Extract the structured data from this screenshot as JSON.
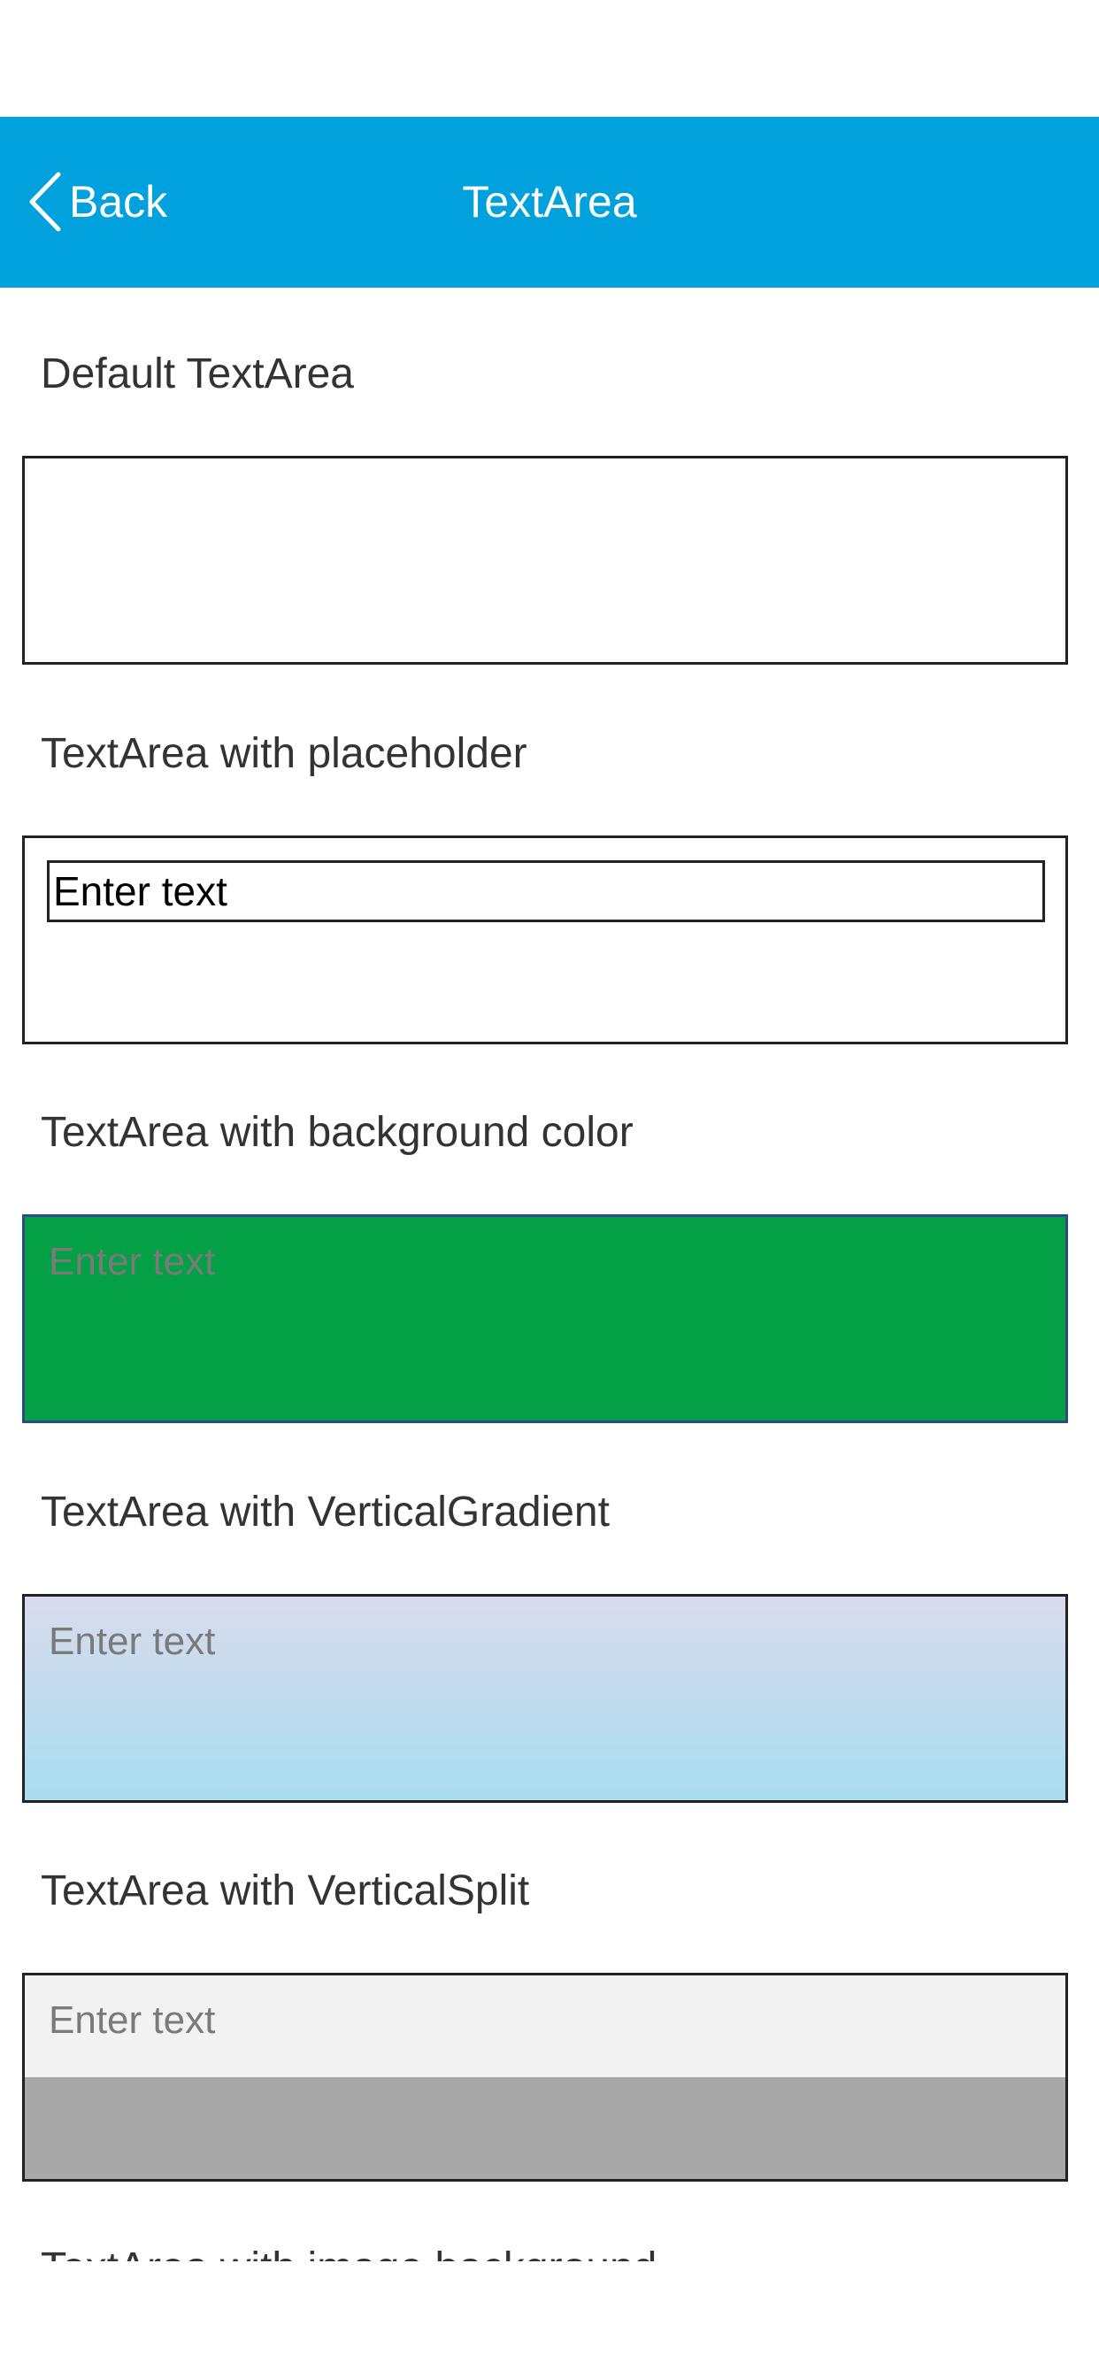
{
  "nav": {
    "back_label": "Back",
    "title": "TextArea",
    "color": "#00a1dd"
  },
  "sections": [
    {
      "label": "Default TextArea",
      "placeholder": ""
    },
    {
      "label": "TextArea with placeholder",
      "placeholder": "Enter text"
    },
    {
      "label": "TextArea with background color",
      "placeholder": "Enter text",
      "background": "#03a045"
    },
    {
      "label": "TextArea with VerticalGradient",
      "placeholder": "Enter text",
      "gradient": [
        "#d8dcec",
        "#a8dcf0"
      ]
    },
    {
      "label": "TextArea with VerticalSplit",
      "placeholder": "Enter text",
      "split": [
        "#f2f2f2",
        "#a8a8a8"
      ]
    },
    {
      "label": "TextArea with image background"
    }
  ]
}
